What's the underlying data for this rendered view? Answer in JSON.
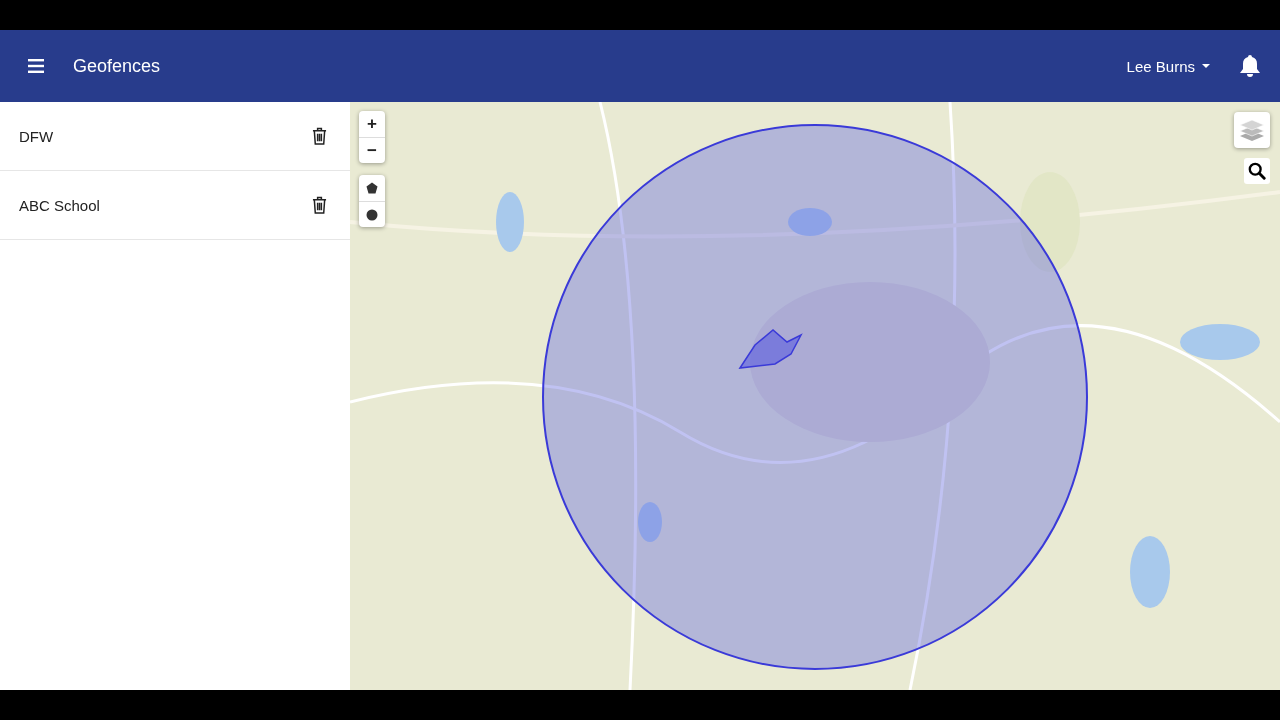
{
  "header": {
    "title": "Geofences",
    "user": "Lee Burns"
  },
  "geofences": [
    {
      "name": "DFW"
    },
    {
      "name": "ABC School"
    }
  ],
  "map_controls": {
    "zoom_in": "+",
    "zoom_out": "−"
  }
}
